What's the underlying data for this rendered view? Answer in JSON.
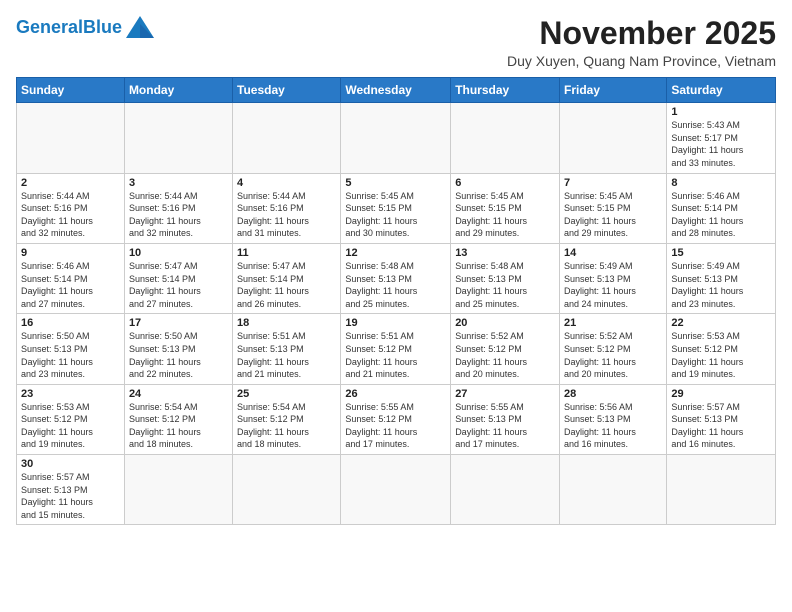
{
  "header": {
    "logo_general": "General",
    "logo_blue": "Blue",
    "month_title": "November 2025",
    "subtitle": "Duy Xuyen, Quang Nam Province, Vietnam"
  },
  "weekdays": [
    "Sunday",
    "Monday",
    "Tuesday",
    "Wednesday",
    "Thursday",
    "Friday",
    "Saturday"
  ],
  "weeks": [
    [
      {
        "day": "",
        "info": ""
      },
      {
        "day": "",
        "info": ""
      },
      {
        "day": "",
        "info": ""
      },
      {
        "day": "",
        "info": ""
      },
      {
        "day": "",
        "info": ""
      },
      {
        "day": "",
        "info": ""
      },
      {
        "day": "1",
        "info": "Sunrise: 5:43 AM\nSunset: 5:17 PM\nDaylight: 11 hours\nand 33 minutes."
      }
    ],
    [
      {
        "day": "2",
        "info": "Sunrise: 5:44 AM\nSunset: 5:16 PM\nDaylight: 11 hours\nand 32 minutes."
      },
      {
        "day": "3",
        "info": "Sunrise: 5:44 AM\nSunset: 5:16 PM\nDaylight: 11 hours\nand 32 minutes."
      },
      {
        "day": "4",
        "info": "Sunrise: 5:44 AM\nSunset: 5:16 PM\nDaylight: 11 hours\nand 31 minutes."
      },
      {
        "day": "5",
        "info": "Sunrise: 5:45 AM\nSunset: 5:15 PM\nDaylight: 11 hours\nand 30 minutes."
      },
      {
        "day": "6",
        "info": "Sunrise: 5:45 AM\nSunset: 5:15 PM\nDaylight: 11 hours\nand 29 minutes."
      },
      {
        "day": "7",
        "info": "Sunrise: 5:45 AM\nSunset: 5:15 PM\nDaylight: 11 hours\nand 29 minutes."
      },
      {
        "day": "8",
        "info": "Sunrise: 5:46 AM\nSunset: 5:14 PM\nDaylight: 11 hours\nand 28 minutes."
      }
    ],
    [
      {
        "day": "9",
        "info": "Sunrise: 5:46 AM\nSunset: 5:14 PM\nDaylight: 11 hours\nand 27 minutes."
      },
      {
        "day": "10",
        "info": "Sunrise: 5:47 AM\nSunset: 5:14 PM\nDaylight: 11 hours\nand 27 minutes."
      },
      {
        "day": "11",
        "info": "Sunrise: 5:47 AM\nSunset: 5:14 PM\nDaylight: 11 hours\nand 26 minutes."
      },
      {
        "day": "12",
        "info": "Sunrise: 5:48 AM\nSunset: 5:13 PM\nDaylight: 11 hours\nand 25 minutes."
      },
      {
        "day": "13",
        "info": "Sunrise: 5:48 AM\nSunset: 5:13 PM\nDaylight: 11 hours\nand 25 minutes."
      },
      {
        "day": "14",
        "info": "Sunrise: 5:49 AM\nSunset: 5:13 PM\nDaylight: 11 hours\nand 24 minutes."
      },
      {
        "day": "15",
        "info": "Sunrise: 5:49 AM\nSunset: 5:13 PM\nDaylight: 11 hours\nand 23 minutes."
      }
    ],
    [
      {
        "day": "16",
        "info": "Sunrise: 5:50 AM\nSunset: 5:13 PM\nDaylight: 11 hours\nand 23 minutes."
      },
      {
        "day": "17",
        "info": "Sunrise: 5:50 AM\nSunset: 5:13 PM\nDaylight: 11 hours\nand 22 minutes."
      },
      {
        "day": "18",
        "info": "Sunrise: 5:51 AM\nSunset: 5:13 PM\nDaylight: 11 hours\nand 21 minutes."
      },
      {
        "day": "19",
        "info": "Sunrise: 5:51 AM\nSunset: 5:12 PM\nDaylight: 11 hours\nand 21 minutes."
      },
      {
        "day": "20",
        "info": "Sunrise: 5:52 AM\nSunset: 5:12 PM\nDaylight: 11 hours\nand 20 minutes."
      },
      {
        "day": "21",
        "info": "Sunrise: 5:52 AM\nSunset: 5:12 PM\nDaylight: 11 hours\nand 20 minutes."
      },
      {
        "day": "22",
        "info": "Sunrise: 5:53 AM\nSunset: 5:12 PM\nDaylight: 11 hours\nand 19 minutes."
      }
    ],
    [
      {
        "day": "23",
        "info": "Sunrise: 5:53 AM\nSunset: 5:12 PM\nDaylight: 11 hours\nand 19 minutes."
      },
      {
        "day": "24",
        "info": "Sunrise: 5:54 AM\nSunset: 5:12 PM\nDaylight: 11 hours\nand 18 minutes."
      },
      {
        "day": "25",
        "info": "Sunrise: 5:54 AM\nSunset: 5:12 PM\nDaylight: 11 hours\nand 18 minutes."
      },
      {
        "day": "26",
        "info": "Sunrise: 5:55 AM\nSunset: 5:12 PM\nDaylight: 11 hours\nand 17 minutes."
      },
      {
        "day": "27",
        "info": "Sunrise: 5:55 AM\nSunset: 5:13 PM\nDaylight: 11 hours\nand 17 minutes."
      },
      {
        "day": "28",
        "info": "Sunrise: 5:56 AM\nSunset: 5:13 PM\nDaylight: 11 hours\nand 16 minutes."
      },
      {
        "day": "29",
        "info": "Sunrise: 5:57 AM\nSunset: 5:13 PM\nDaylight: 11 hours\nand 16 minutes."
      }
    ],
    [
      {
        "day": "30",
        "info": "Sunrise: 5:57 AM\nSunset: 5:13 PM\nDaylight: 11 hours\nand 15 minutes."
      },
      {
        "day": "",
        "info": ""
      },
      {
        "day": "",
        "info": ""
      },
      {
        "day": "",
        "info": ""
      },
      {
        "day": "",
        "info": ""
      },
      {
        "day": "",
        "info": ""
      },
      {
        "day": "",
        "info": ""
      }
    ]
  ]
}
